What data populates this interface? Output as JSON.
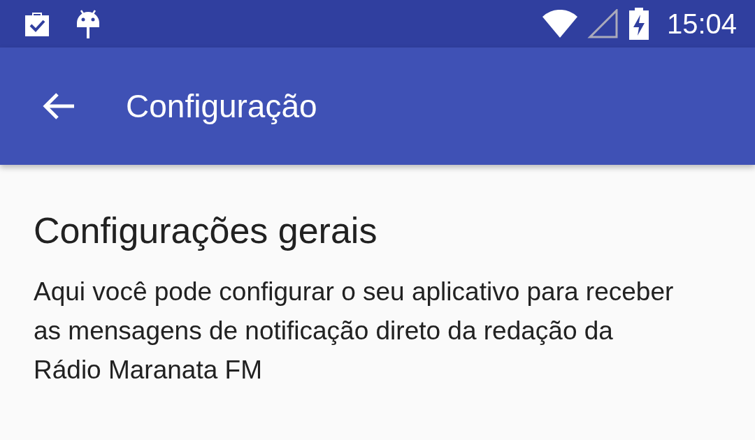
{
  "status_bar": {
    "time": "15:04"
  },
  "app_bar": {
    "title": "Configuração"
  },
  "section": {
    "title": "Configurações gerais",
    "description": "Aqui você pode configurar o seu aplicativo para receber as mensagens de notificação direto da redação da Rádio Maranata FM"
  }
}
